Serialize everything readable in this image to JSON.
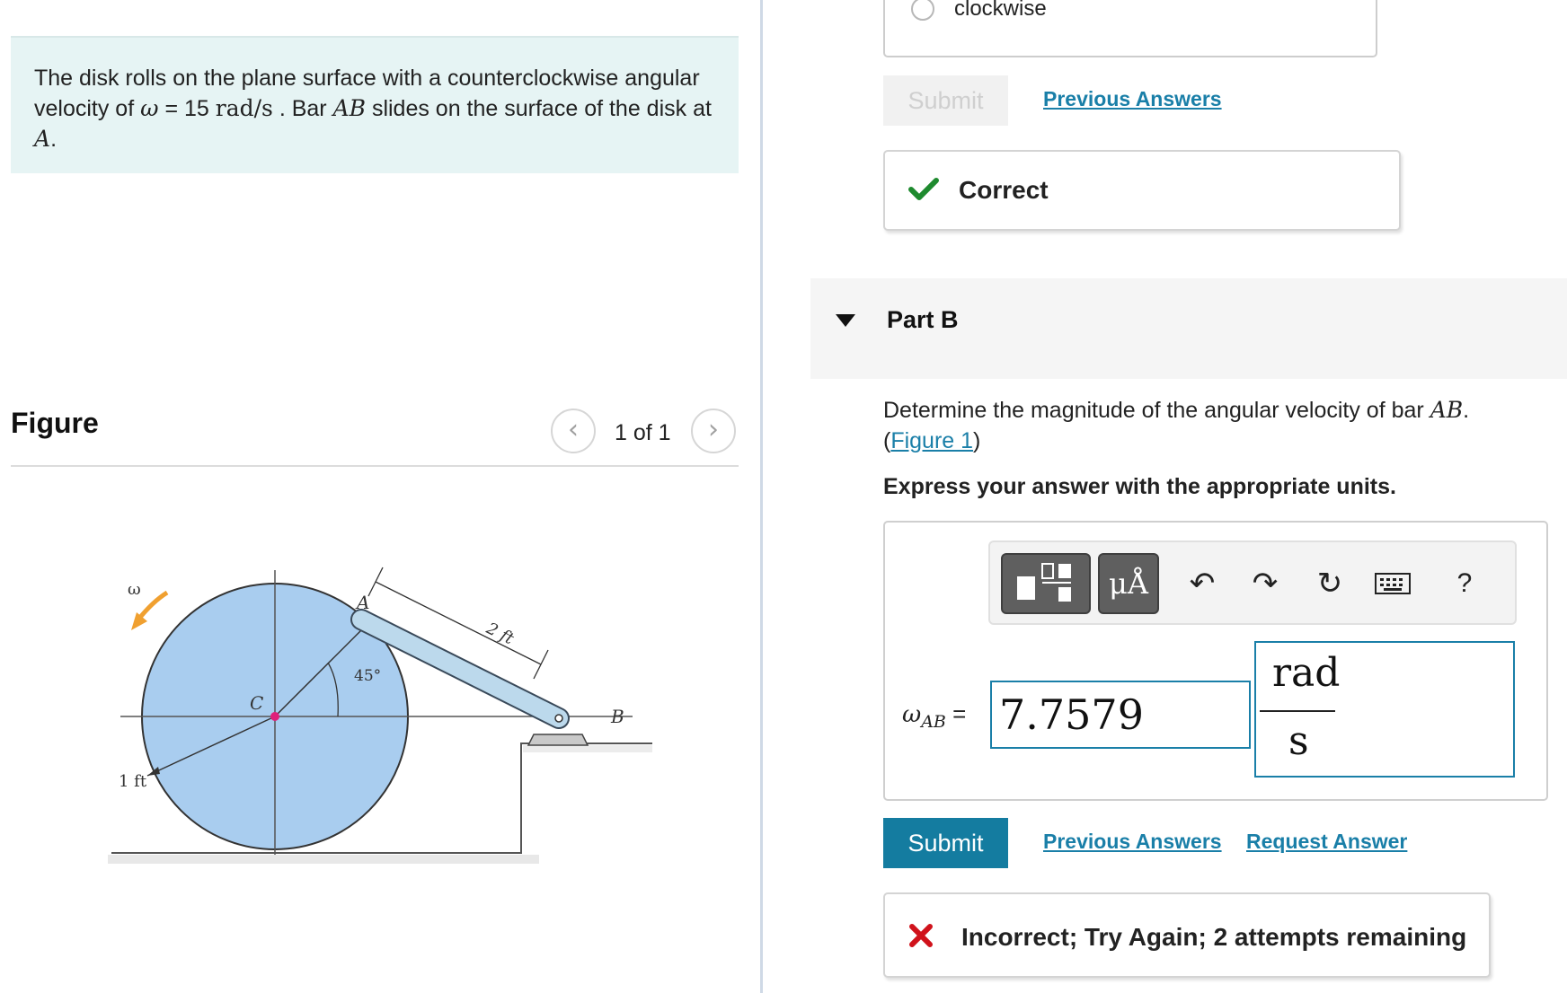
{
  "problem": {
    "text1": "The disk rolls on the plane surface with a counterclockwise angular velocity of ",
    "omega": "ω",
    "eq": " = 15 ",
    "units": "rad/s",
    "text2": " . Bar ",
    "bar": "AB",
    "text3": " slides on the surface of the disk at ",
    "pointA": "A",
    "text4": "."
  },
  "figure": {
    "label": "Figure",
    "pager": "1 of 1",
    "prev_icon": "chevron-left-icon",
    "next_icon": "chevron-right-icon",
    "labels": {
      "omega": "ω",
      "a": "A",
      "b": "B",
      "c": "C",
      "angle": "45°",
      "length": "2 ft",
      "radius": "1 ft"
    },
    "colors": {
      "disk": "#a9cdef",
      "bar": "#bcd9ec",
      "arrow": "#f0a030",
      "center": "#e0207a"
    }
  },
  "part_a": {
    "choice_label": "clockwise",
    "submit": "Submit",
    "previous_answers": "Previous Answers",
    "feedback": "Correct",
    "feedback_icon": "checkmark-icon",
    "feedback_color": "#1e8a2e"
  },
  "part_b": {
    "title": "Part B",
    "question_text": "Determine the magnitude of the angular velocity of bar ",
    "question_bar": "AB",
    "question_end": ".",
    "figure_paren_open": "(",
    "figure_link": "Figure 1",
    "figure_paren_close": ")",
    "instruction": "Express your answer with the appropriate units.",
    "toolbar": [
      "templates-icon",
      "units-icon",
      "undo-icon",
      "redo-icon",
      "reset-icon",
      "keyboard-icon",
      "help-icon"
    ],
    "units_button": "μÅ",
    "help": "?",
    "variable": "ω",
    "variable_sub": "AB",
    "equals": " =",
    "value": "7.7579",
    "unit_numerator": "rad",
    "unit_denominator": "s",
    "submit": "Submit",
    "previous_answers": "Previous Answers",
    "request_answer": "Request Answer",
    "feedback": "Incorrect; Try Again; 2 attempts remaining",
    "feedback_icon": "x-mark-icon",
    "feedback_color": "#d0121b"
  }
}
